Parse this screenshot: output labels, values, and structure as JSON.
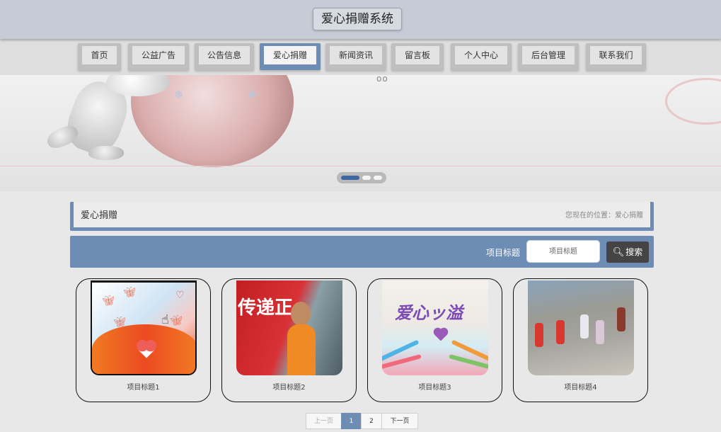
{
  "header": {
    "title": "爱心捐赠系统"
  },
  "nav": {
    "items": [
      {
        "label": "首页",
        "active": false
      },
      {
        "label": "公益广告",
        "active": false
      },
      {
        "label": "公告信息",
        "active": false
      },
      {
        "label": "爱心捐赠",
        "active": true
      },
      {
        "label": "新闻资讯",
        "active": false
      },
      {
        "label": "留言板",
        "active": false
      },
      {
        "label": "个人中心",
        "active": false
      },
      {
        "label": "后台管理",
        "active": false
      },
      {
        "label": "联系我们",
        "active": false
      }
    ]
  },
  "banner": {
    "slide_count": 3,
    "active_slide": 1
  },
  "breadcrumb": {
    "title": "爱心捐赠",
    "path": "您现在的位置：爱心捐赠"
  },
  "search": {
    "label": "项目标题",
    "placeholder": "项目标题",
    "value": "",
    "button_label": "搜索"
  },
  "cards": [
    {
      "title": "项目标题1",
      "image": "hands-heart-butterflies"
    },
    {
      "title": "项目标题2",
      "image": "volunteer-painting-banner"
    },
    {
      "title": "项目标题3",
      "image": "love-poster"
    },
    {
      "title": "项目标题4",
      "image": "volunteers-sweeping"
    }
  ],
  "pagination": {
    "prev": "上一页",
    "pages": [
      "1",
      "2"
    ],
    "current": "1",
    "next": "下一页"
  },
  "colors": {
    "accent": "#6e8db4",
    "header_bg": "#c5ccd6",
    "page_bg": "#e8e8e8",
    "search_button": "#444444"
  }
}
